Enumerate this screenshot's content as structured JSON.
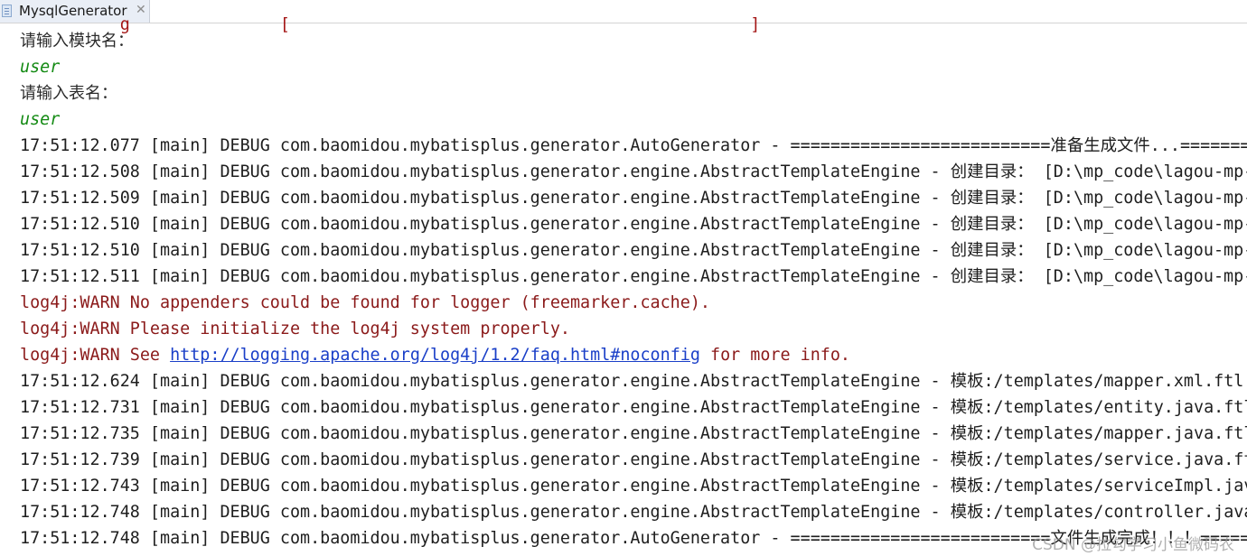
{
  "tab": {
    "title": "MysqlGenerator",
    "close_glyph": "✕",
    "icon": "console-file-icon"
  },
  "console": {
    "cut_top": "          g               [                                              ]",
    "lines": [
      {
        "kind": "prompt",
        "text": "请输入模块名："
      },
      {
        "kind": "input",
        "text": "user"
      },
      {
        "kind": "prompt",
        "text": "请输入表名："
      },
      {
        "kind": "input",
        "text": "user"
      },
      {
        "kind": "normal",
        "text": "17:51:12.077 [main] DEBUG com.baomidou.mybatisplus.generator.AutoGenerator - ==========================准备生成文件...=========="
      },
      {
        "kind": "normal",
        "text": "17:51:12.508 [main] DEBUG com.baomidou.mybatisplus.generator.engine.AbstractTemplateEngine - 创建目录： [D:\\mp_code\\lagou-mp-"
      },
      {
        "kind": "normal",
        "text": "17:51:12.509 [main] DEBUG com.baomidou.mybatisplus.generator.engine.AbstractTemplateEngine - 创建目录： [D:\\mp_code\\lagou-mp-"
      },
      {
        "kind": "normal",
        "text": "17:51:12.510 [main] DEBUG com.baomidou.mybatisplus.generator.engine.AbstractTemplateEngine - 创建目录： [D:\\mp_code\\lagou-mp-"
      },
      {
        "kind": "normal",
        "text": "17:51:12.510 [main] DEBUG com.baomidou.mybatisplus.generator.engine.AbstractTemplateEngine - 创建目录： [D:\\mp_code\\lagou-mp-"
      },
      {
        "kind": "normal",
        "text": "17:51:12.511 [main] DEBUG com.baomidou.mybatisplus.generator.engine.AbstractTemplateEngine - 创建目录： [D:\\mp_code\\lagou-mp-"
      },
      {
        "kind": "warn",
        "text": "log4j:WARN No appenders could be found for logger (freemarker.cache)."
      },
      {
        "kind": "warn",
        "text": "log4j:WARN Please initialize the log4j system properly."
      },
      {
        "kind": "warn-link",
        "before": "log4j:WARN See ",
        "link": "http://logging.apache.org/log4j/1.2/faq.html#noconfig",
        "after": " for more info."
      },
      {
        "kind": "normal",
        "text": "17:51:12.624 [main] DEBUG com.baomidou.mybatisplus.generator.engine.AbstractTemplateEngine - 模板:/templates/mapper.xml.ftl;"
      },
      {
        "kind": "normal",
        "text": "17:51:12.731 [main] DEBUG com.baomidou.mybatisplus.generator.engine.AbstractTemplateEngine - 模板:/templates/entity.java.ftl"
      },
      {
        "kind": "normal",
        "text": "17:51:12.735 [main] DEBUG com.baomidou.mybatisplus.generator.engine.AbstractTemplateEngine - 模板:/templates/mapper.java.ftl"
      },
      {
        "kind": "normal",
        "text": "17:51:12.739 [main] DEBUG com.baomidou.mybatisplus.generator.engine.AbstractTemplateEngine - 模板:/templates/service.java.ftl"
      },
      {
        "kind": "normal",
        "text": "17:51:12.743 [main] DEBUG com.baomidou.mybatisplus.generator.engine.AbstractTemplateEngine - 模板:/templates/serviceImpl.java"
      },
      {
        "kind": "normal",
        "text": "17:51:12.748 [main] DEBUG com.baomidou.mybatisplus.generator.engine.AbstractTemplateEngine - 模板:/templates/controller.java"
      },
      {
        "kind": "normal",
        "text": "17:51:12.748 [main] DEBUG com.baomidou.mybatisplus.generator.AutoGenerator - ==========================文件生成完成！！！=========="
      }
    ]
  },
  "watermark": "CSDN @拉勾学习小鱼微码农"
}
